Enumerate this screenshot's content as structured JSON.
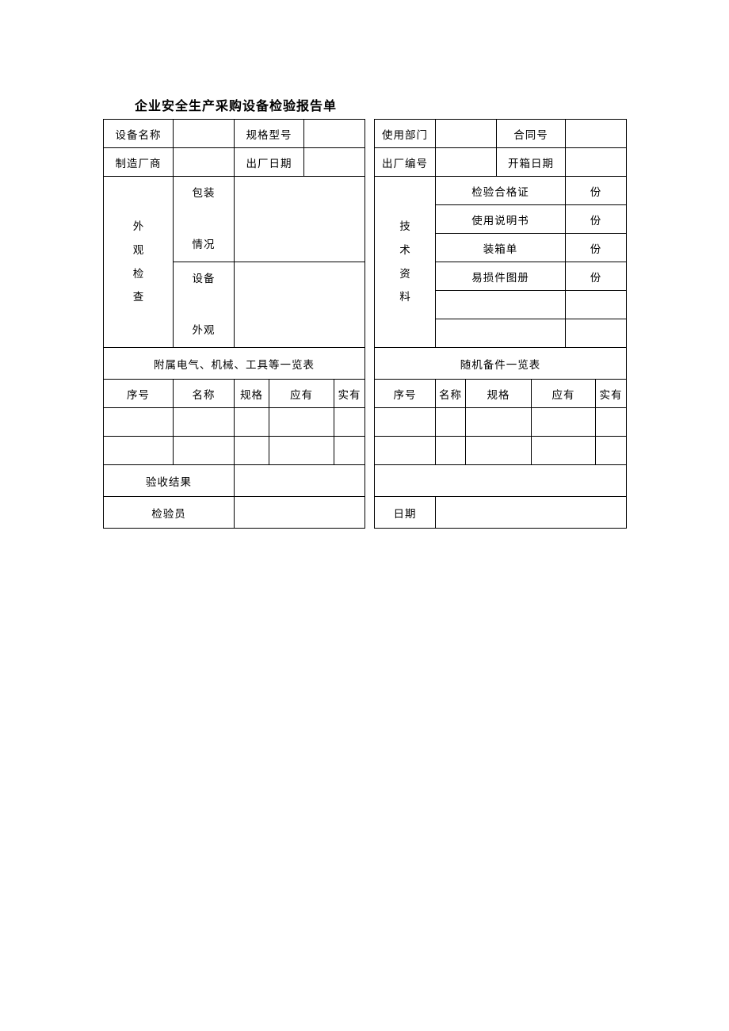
{
  "title": "企业安全生产采购设备检验报告单",
  "row1": {
    "c1": "设备名称",
    "c2": "规格型号",
    "c3": "使用部门",
    "c4": "合同号"
  },
  "row2": {
    "c1": "制造厂商",
    "c2": "出厂日期",
    "c3": "出厂编号",
    "c4": "开箱日期"
  },
  "appearance": {
    "label": "外\n观\n检\n查",
    "sub1": "包装",
    "sub2": "情况",
    "sub3": "设备",
    "sub4": "外观"
  },
  "tech": {
    "label": "技\n术\n资\n料",
    "docs": {
      "d1": "检验合格证",
      "u": "份",
      "d2": "使用说明书",
      "d3": "装箱单",
      "d4": "易损件图册"
    }
  },
  "section": {
    "left": "附属电气、机械、工具等一览表",
    "right": "随机备件一览表"
  },
  "cols": {
    "seq": "序号",
    "name": "名称",
    "spec": "规格",
    "should": "应有",
    "actual": "实有"
  },
  "footer": {
    "result": "验收结果",
    "inspector": "检验员",
    "date": "日期"
  }
}
